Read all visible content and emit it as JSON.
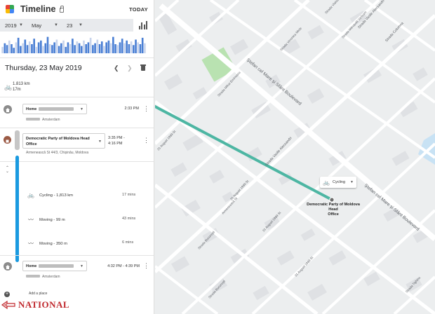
{
  "header": {
    "title": "Timeline",
    "today_label": "TODAY",
    "app_icon": "google-maps-icon",
    "lock_icon": "lock-icon"
  },
  "selectors": {
    "year": "2019",
    "month": "May",
    "day": "23"
  },
  "date_header": "Thursday, 23 May 2019",
  "summary": {
    "distance": "1.813 km",
    "duration": "17m",
    "icon": "bicycle-icon"
  },
  "visits": [
    {
      "name": "Home",
      "address": "Amsterdam",
      "time": "2:33 PM",
      "icon": "home-icon"
    },
    {
      "name": "Democratic Party of Moldova Head Office",
      "name_line1": "Democratic Party of Moldova Head",
      "name_line2": "Office",
      "address": "Armenească St 44/3, Chișinău, Moldova",
      "time_start": "3:35 PM -",
      "time_end": "4:16 PM",
      "icon": "place-icon"
    },
    {
      "name": "Home",
      "address": "Amsterdam",
      "time": "4:32 PM - 4:39 PM",
      "icon": "home-icon"
    }
  ],
  "activities": [
    {
      "label": "Cycling - 1,813 km",
      "duration": "17 mins",
      "icon": "bicycle-icon"
    },
    {
      "label": "Moving - 99 m",
      "duration": "43 mins",
      "icon": "moving-icon"
    },
    {
      "label": "Moving - 350 m",
      "duration": "6 mins",
      "icon": "moving-icon"
    }
  ],
  "add_place_label": "Add a place",
  "histogram": {
    "values": [
      0.35,
      0.55,
      0.45,
      0.7,
      0.5,
      0.3,
      0.6,
      0.85,
      0.4,
      0.55,
      0.75,
      0.45,
      0.65,
      0.5,
      0.8,
      0.35,
      0.6,
      0.7,
      0.4,
      0.55,
      0.9,
      0.5,
      0.45,
      0.6,
      0.75,
      0.4,
      0.55,
      0.7,
      0.35,
      0.6,
      0.5,
      0.8,
      0.45,
      0.65,
      0.55,
      0.4,
      0.7,
      0.5,
      0.6,
      0.85,
      0.45,
      0.55,
      0.75,
      0.5,
      0.65,
      0.4,
      0.6,
      0.7,
      0.55,
      0.9,
      0.5,
      0.45,
      0.6,
      0.8,
      0.55,
      0.7,
      0.5,
      0.65,
      0.45,
      0.75,
      0.6,
      0.5,
      0.85,
      0.55
    ],
    "highlight_color": "#4a7fd4",
    "muted_color": "#c8d4ec"
  },
  "map": {
    "chip_label": "Cycling",
    "place_label_line1": "Democratic Party of Moldova Head",
    "place_label_line2": "Office",
    "route_color": "#4db6a3",
    "roads": [
      "Ștefan cel Mare și Sfânt Boulevard",
      "Strada Vasile Alecsandri",
      "Strada Columna",
      "Strada Vlaicu Pârcălab",
      "Strada București",
      "31 August 1989 St",
      "Armenească St",
      "Strada Mitropolit Varlaam",
      "Strada Tighina",
      "Strada Mihai Eminescu",
      "Strada Veronica Micle"
    ]
  },
  "watermark": "NATIONAL",
  "colors": {
    "timeline_blue": "#1a9ae0",
    "park_green": "#b9e2b1"
  }
}
